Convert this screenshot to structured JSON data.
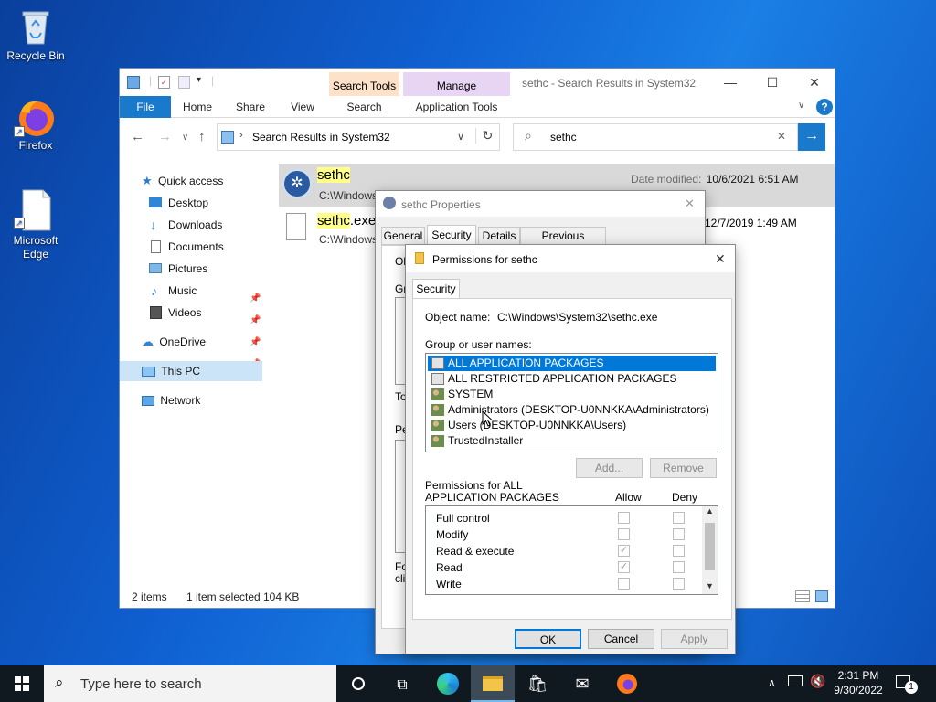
{
  "desktop": {
    "icons": [
      {
        "label": "Recycle Bin"
      },
      {
        "label": "Firefox"
      },
      {
        "label": "Microsoft Edge"
      }
    ]
  },
  "explorer": {
    "title": "sethc - Search Results in System32",
    "context_tabs": {
      "search_tools": "Search Tools",
      "manage": "Manage"
    },
    "ribbon_tabs": [
      "File",
      "Home",
      "Share",
      "View",
      "Search",
      "Application Tools"
    ],
    "address": "Search Results in System32",
    "search_query": "sethc",
    "nav": {
      "quick_access": "Quick access",
      "items": [
        "Desktop",
        "Downloads",
        "Documents",
        "Pictures",
        "Music",
        "Videos"
      ],
      "onedrive": "OneDrive",
      "this_pc": "This PC",
      "network": "Network"
    },
    "results": [
      {
        "name_hl": "sethc",
        "name_rest": "",
        "path": "C:\\Windows",
        "meta_label": "Date modified:",
        "meta_value": "10/6/2021 6:51 AM"
      },
      {
        "name_hl": "sethc",
        "name_rest": ".exe.",
        "path": "C:\\Windows",
        "meta_label": "",
        "meta_value": "12/7/2019 1:49 AM"
      }
    ],
    "status": {
      "items": "2 items",
      "selected": "1 item selected",
      "size": "104 KB"
    }
  },
  "properties_dialog": {
    "title": "sethc Properties",
    "tabs": [
      "General",
      "Security",
      "Details",
      "Previous Versions"
    ],
    "partial": [
      "Ob",
      "Gro",
      "To",
      "Pe",
      "Fo",
      "clic"
    ]
  },
  "permissions_dialog": {
    "title": "Permissions for sethc",
    "tab": "Security",
    "object_name_label": "Object name:",
    "object_name_value": "C:\\Windows\\System32\\sethc.exe",
    "group_label": "Group or user names:",
    "groups": [
      "ALL APPLICATION PACKAGES",
      "ALL RESTRICTED APPLICATION PACKAGES",
      "SYSTEM",
      "Administrators (DESKTOP-U0NNKKA\\Administrators)",
      "Users (DESKTOP-U0NNKKA\\Users)",
      "TrustedInstaller"
    ],
    "selected_group_index": 0,
    "add_label": "Add...",
    "remove_label": "Remove",
    "perm_header_line1": "Permissions for ALL",
    "perm_header_line2": "APPLICATION PACKAGES",
    "allow_label": "Allow",
    "deny_label": "Deny",
    "permissions": [
      {
        "name": "Full control",
        "allow": false,
        "deny": false
      },
      {
        "name": "Modify",
        "allow": false,
        "deny": false
      },
      {
        "name": "Read & execute",
        "allow": true,
        "deny": false
      },
      {
        "name": "Read",
        "allow": true,
        "deny": false
      },
      {
        "name": "Write",
        "allow": false,
        "deny": false
      }
    ],
    "ok_label": "OK",
    "cancel_label": "Cancel",
    "apply_label": "Apply"
  },
  "taskbar": {
    "search_placeholder": "Type here to search",
    "time": "2:31 PM",
    "date": "9/30/2022",
    "notification_count": "1"
  },
  "colors": {
    "accent": "#1979ca",
    "selection": "#0078d7",
    "search_highlight": "#ffff8a"
  }
}
